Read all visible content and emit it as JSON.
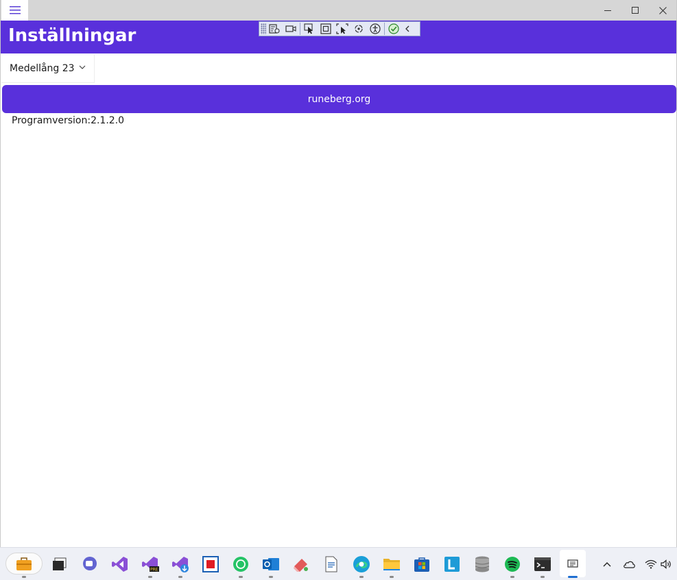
{
  "app": {
    "title": "Inställningar",
    "accent_color": "#5930db"
  },
  "titlebar": {
    "menu_icon": "hamburger-icon",
    "controls": [
      "minimize-icon",
      "maximize-icon",
      "close-icon"
    ]
  },
  "debug_toolbar": {
    "icons": [
      "live-visual-tree-icon",
      "video-camera-icon",
      "select-element-icon",
      "display-layout-adorners-icon",
      "track-focus-icon",
      "hot-reload-icon",
      "accessibility-icon",
      "check-circle-icon",
      "collapse-chevron-icon"
    ]
  },
  "settings": {
    "text_size_selected": "Medellång 23",
    "link_button_label": "runeberg.org",
    "version_text": "Programversion:2.1.2.0"
  },
  "taskbar": {
    "apps": [
      "briefcase-icon",
      "terminal-window-icon",
      "teams-icon",
      "visual-studio-icon",
      "visual-studio-preview-icon",
      "visual-studio-installer-icon",
      "red-square-app-icon",
      "whatsapp-icon",
      "outlook-icon",
      "eraser-app-icon",
      "document-icon",
      "edge-icon",
      "file-explorer-icon",
      "microsoft-store-icon",
      "l-app-icon",
      "database-icon",
      "spotify-icon",
      "windows-terminal-icon",
      "active-app-icon"
    ],
    "tray": [
      "chevron-up-icon",
      "onedrive-cloud-icon",
      "wifi-icon",
      "volume-icon"
    ]
  }
}
